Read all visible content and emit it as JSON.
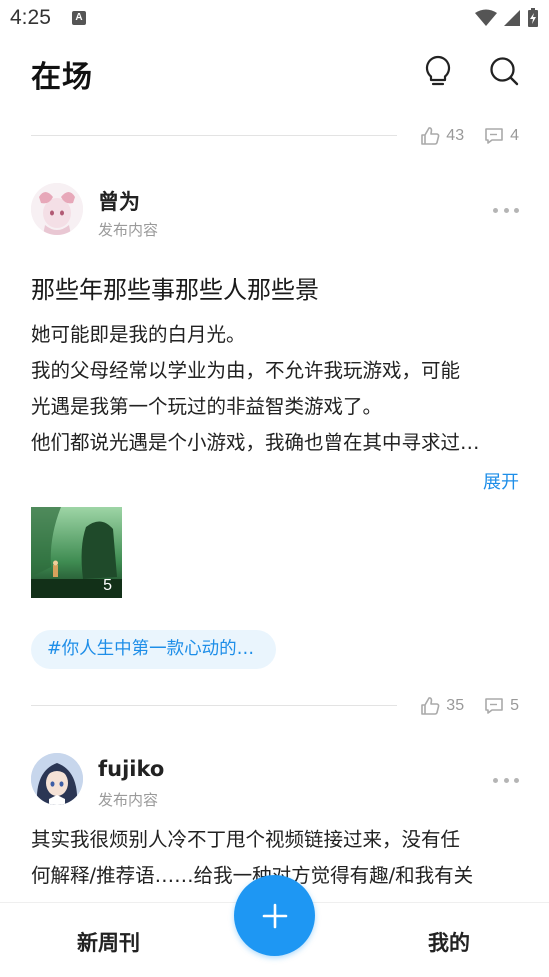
{
  "status_bar": {
    "time": "4:25",
    "notification_icon_letter": "A"
  },
  "header": {
    "title": "在场"
  },
  "top_stats": {
    "likes": "43",
    "comments": "4"
  },
  "posts": [
    {
      "author": "曾为",
      "subline": "发布内容",
      "title": "那些年那些事那些人那些景",
      "body": [
        "她可能即是我的白月光。",
        "我的父母经常以学业为由，不允许我玩游戏，可能",
        "光遇是我第一个玩过的非益智类游戏了。",
        "他们都说光遇是个小游戏，我确也曾在其中寻求过…"
      ],
      "expand_label": "展开",
      "image_count": "5",
      "tag": "#你人生中第一款心动的…",
      "likes": "35",
      "comments": "5"
    },
    {
      "author": "fujiko",
      "subline": "发布内容",
      "body": [
        "其实我很烦别人冷不丁甩个视频链接过来，没有任",
        "何解释/推荐语……给我一种对方觉得有趣/和我有关"
      ]
    }
  ],
  "bottom_nav": {
    "left_tab": "新周刊",
    "right_tab": "我的"
  },
  "colors": {
    "accent": "#1e97f3",
    "link": "#1e8ee8",
    "muted": "#999999"
  }
}
